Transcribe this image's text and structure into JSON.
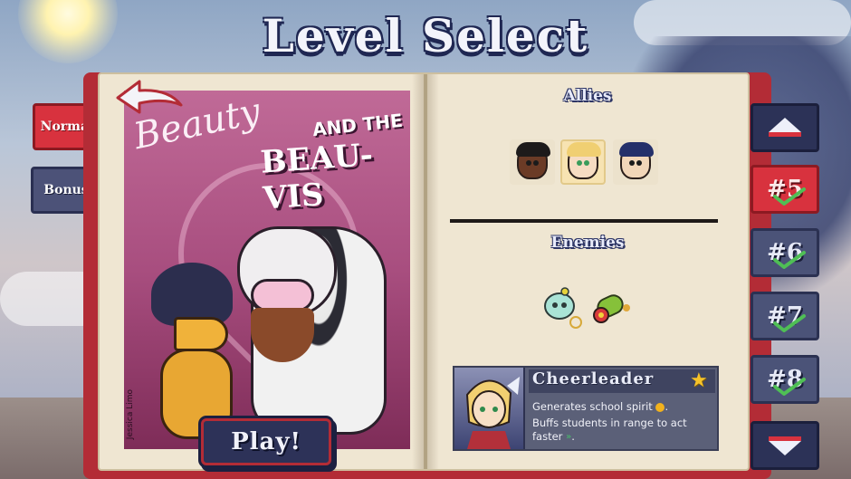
{
  "title": "Level Select",
  "mode_tabs": [
    {
      "label": "Normal",
      "state": "active"
    },
    {
      "label": "Bonus",
      "state": "inactive"
    }
  ],
  "book": {
    "cover": {
      "script_title": "Beauty",
      "and_the": "AND THE",
      "subtitle": "BEAU-VIS",
      "signature": "Jessica Limo"
    },
    "play_label": "Play!"
  },
  "allies": {
    "heading": "Allies",
    "portraits": [
      {
        "name": "ally-dark-haired-girl",
        "selected": false
      },
      {
        "name": "ally-cheerleader",
        "selected": true
      },
      {
        "name": "ally-blue-haired-boy",
        "selected": false
      }
    ]
  },
  "enemies": {
    "heading": "Enemies",
    "icons": [
      "ghost-skull-enemy",
      "green-cannon-enemy"
    ]
  },
  "info_card": {
    "title": "Cheerleader",
    "star_icon": "star-icon",
    "line1": "Generates school spirit",
    "line2": "Buffs students in range to act faster"
  },
  "levels": [
    {
      "label": "#5",
      "selected": true,
      "completed": true
    },
    {
      "label": "#6",
      "selected": false,
      "completed": true
    },
    {
      "label": "#7",
      "selected": false,
      "completed": true
    },
    {
      "label": "#8",
      "selected": false,
      "completed": true
    }
  ],
  "colors": {
    "accent_red": "#d8323e",
    "navy": "#2c3257",
    "page": "#efe6d2",
    "check_green": "#4fbf55"
  }
}
